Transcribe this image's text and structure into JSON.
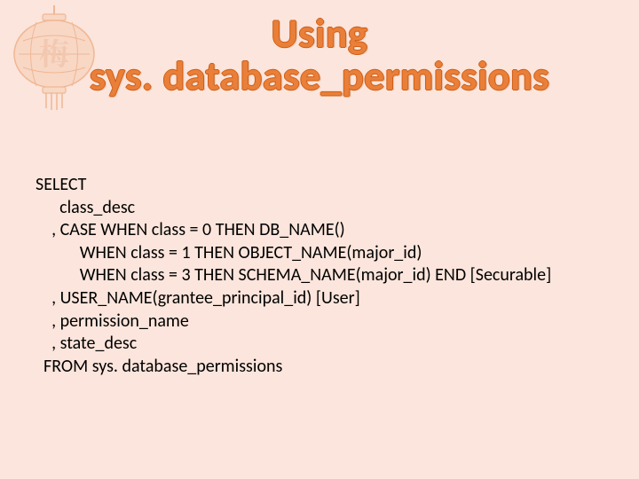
{
  "title": {
    "line1": "Using",
    "line2": "sys. database_permissions"
  },
  "code_lines": [
    "SELECT",
    "      class_desc",
    "    , CASE WHEN class = 0 THEN DB_NAME()",
    "           WHEN class = 1 THEN OBJECT_NAME(major_id)",
    "           WHEN class = 3 THEN SCHEMA_NAME(major_id) END [Securable]",
    "    , USER_NAME(grantee_principal_id) [User]",
    "    , permission_name",
    "    , state_desc",
    "  FROM sys. database_permissions"
  ],
  "colors": {
    "background": "#fbe5dc",
    "title": "#e97f38",
    "lantern_body": "#f8d7c5",
    "lantern_stroke": "#f0b793",
    "lantern_char": "#f2c8b0"
  }
}
